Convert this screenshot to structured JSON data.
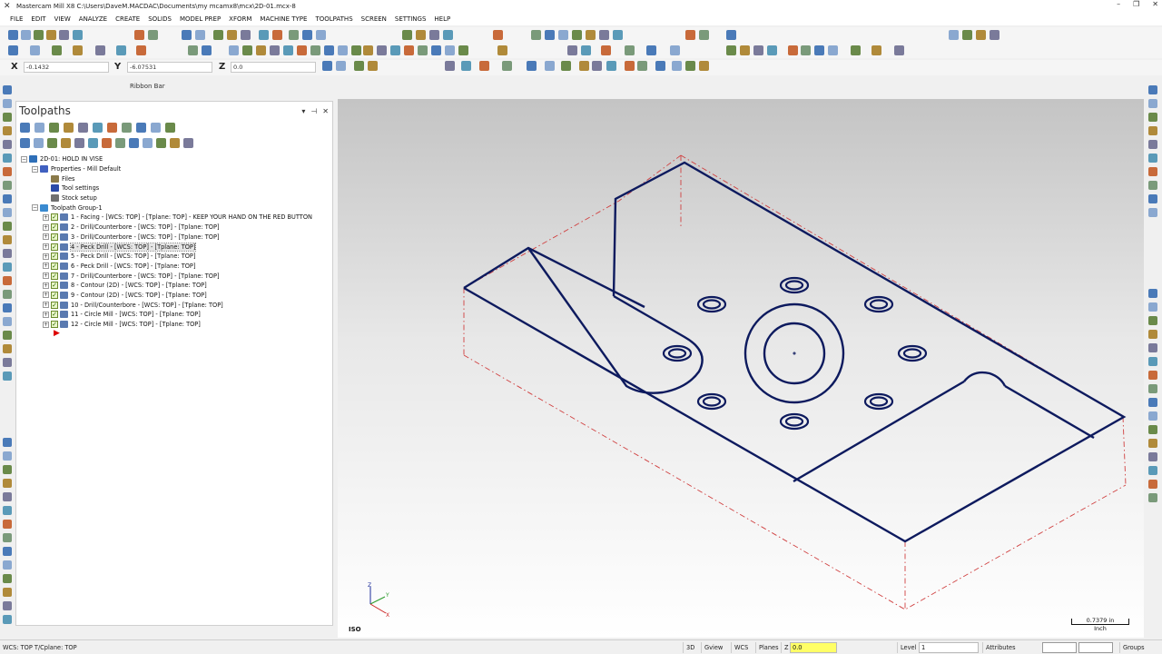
{
  "window": {
    "title": "Mastercam Mill X8  C:\\Users\\DaveM.MACDAC\\Documents\\my mcamx8\\mcx\\2D-01.mcx-8",
    "controls": [
      "–",
      "❐",
      "✕"
    ]
  },
  "menu": [
    "FILE",
    "EDIT",
    "VIEW",
    "ANALYZE",
    "CREATE",
    "SOLIDS",
    "MODEL PREP",
    "XFORM",
    "MACHINE TYPE",
    "TOOLPATHS",
    "SCREEN",
    "SETTINGS",
    "HELP"
  ],
  "coords": {
    "x_label": "X",
    "x_value": "-0.1432",
    "y_label": "Y",
    "y_value": "-6.07531",
    "z_label": "Z",
    "z_value": "0.0"
  },
  "ribbon_bar_label": "Ribbon Bar",
  "panel": {
    "title": "Toolpaths",
    "controls": [
      "▾",
      "⊣",
      "✕"
    ]
  },
  "tree": [
    {
      "indent": 0,
      "expander": "−",
      "icon": "machine-group-icon",
      "label": "2D-01: HOLD IN VISE",
      "checked": false
    },
    {
      "indent": 1,
      "expander": "−",
      "icon": "properties-icon",
      "label": "Properties - Mill Default",
      "checked": false
    },
    {
      "indent": 2,
      "expander": "",
      "icon": "folder-icon",
      "label": "Files",
      "checked": false
    },
    {
      "indent": 2,
      "expander": "",
      "icon": "tool-icon",
      "label": "Tool settings",
      "checked": false
    },
    {
      "indent": 2,
      "expander": "",
      "icon": "stock-icon",
      "label": "Stock setup",
      "checked": false
    },
    {
      "indent": 1,
      "expander": "−",
      "icon": "toolpath-group-icon",
      "label": "Toolpath Group-1",
      "checked": false
    },
    {
      "indent": 2,
      "expander": "+",
      "icon": "op-icon",
      "label": "1 - Facing - [WCS: TOP] - [Tplane: TOP] - KEEP YOUR HAND ON THE RED BUTTON",
      "checked": true
    },
    {
      "indent": 2,
      "expander": "+",
      "icon": "op-icon",
      "label": "2 - Drill/Counterbore - [WCS: TOP] - [Tplane: TOP]",
      "checked": true
    },
    {
      "indent": 2,
      "expander": "+",
      "icon": "op-icon",
      "label": "3 - Drill/Counterbore - [WCS: TOP] - [Tplane: TOP]",
      "checked": true
    },
    {
      "indent": 2,
      "expander": "+",
      "icon": "op-icon",
      "label": "4 - Peck Drill - [WCS: TOP] - [Tplane: TOP]",
      "checked": true,
      "selected": true
    },
    {
      "indent": 2,
      "expander": "+",
      "icon": "op-icon",
      "label": "5 - Peck Drill - [WCS: TOP] - [Tplane: TOP]",
      "checked": true
    },
    {
      "indent": 2,
      "expander": "+",
      "icon": "op-icon",
      "label": "6 - Peck Drill - [WCS: TOP] - [Tplane: TOP]",
      "checked": true
    },
    {
      "indent": 2,
      "expander": "+",
      "icon": "op-icon",
      "label": "7 - Drill/Counterbore - [WCS: TOP] - [Tplane: TOP]",
      "checked": true
    },
    {
      "indent": 2,
      "expander": "+",
      "icon": "op-icon",
      "label": "8 - Contour (2D) - [WCS: TOP] - [Tplane: TOP]",
      "checked": true
    },
    {
      "indent": 2,
      "expander": "+",
      "icon": "op-icon",
      "label": "9 - Contour (2D) - [WCS: TOP] - [Tplane: TOP]",
      "checked": true
    },
    {
      "indent": 2,
      "expander": "+",
      "icon": "op-icon",
      "label": "10 - Drill/Counterbore - [WCS: TOP] - [Tplane: TOP]",
      "checked": true
    },
    {
      "indent": 2,
      "expander": "+",
      "icon": "op-icon",
      "label": "11 - Circle Mill - [WCS: TOP] - [Tplane: TOP]",
      "checked": true
    },
    {
      "indent": 2,
      "expander": "+",
      "icon": "op-icon",
      "label": "12 - Circle Mill - [WCS: TOP] - [Tplane: TOP]",
      "checked": true
    }
  ],
  "viewport": {
    "view_name": "ISO",
    "scale_value": "0.7379 in",
    "scale_unit": "Inch",
    "axis_labels": {
      "x": "X",
      "y": "Y",
      "z": "Z"
    }
  },
  "status": {
    "left": "WCS: TOP  T/Cplane: TOP",
    "btn_3d": "3D",
    "btn_gview": "Gview",
    "btn_wcs": "WCS",
    "btn_planes": "Planes",
    "z_label": "Z",
    "z_value": "0.0",
    "level_label": "Level",
    "level_value": "1",
    "btn_attributes": "Attributes",
    "btn_groups": "Groups"
  },
  "colors": {
    "geometry": "#0d1a5e",
    "stock_outline": "#d04040",
    "viewport_top": "#c4c4c4",
    "viewport_bottom": "#ffffff"
  }
}
